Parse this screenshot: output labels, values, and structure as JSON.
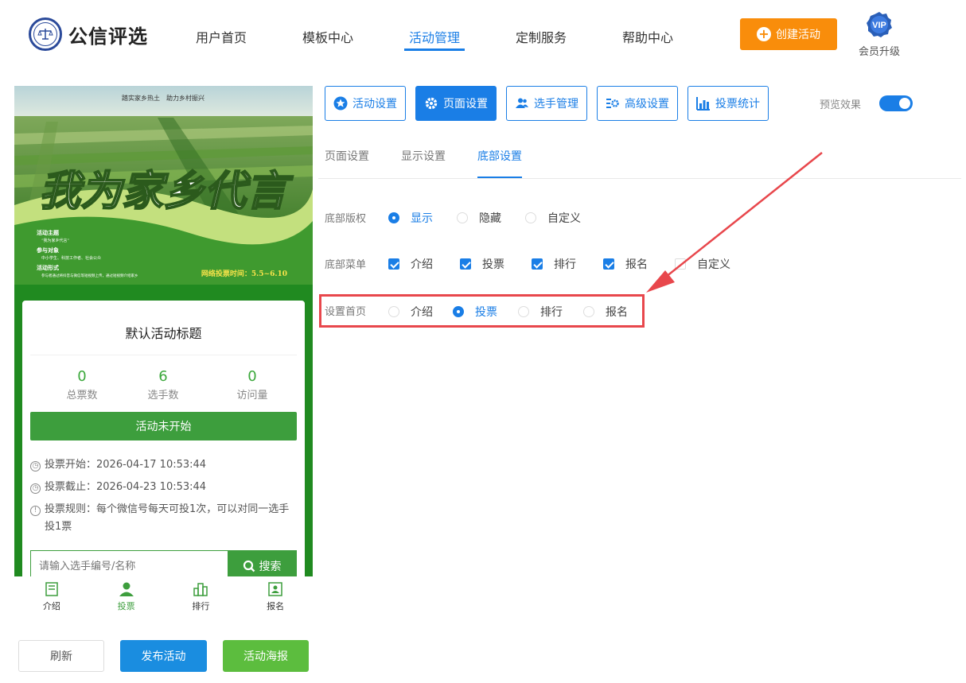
{
  "header": {
    "brand": "公信评选",
    "nav": [
      "用户首页",
      "模板中心",
      "活动管理",
      "定制服务",
      "帮助中心"
    ],
    "active_nav": "活动管理",
    "create_label": "创建活动",
    "vip_badge": "VIP",
    "vip_label": "会员升级"
  },
  "banner": {
    "slogan": "踏实家乡热土　助力乡村振兴",
    "title": "我为家乡代言",
    "theme_label": "活动主题",
    "theme_value": "“我为家乡代言”",
    "target_label": "参与对象",
    "target_value": "中小学生、科技工作者、社会公众",
    "form_label": "活动形式",
    "form_value": "参与者通过将抖音与微信等短视频上传，通过短视频介绍家乡",
    "vote_time": "网络投票时间：5.5~6.10"
  },
  "card": {
    "title": "默认活动标题",
    "stats": [
      {
        "value": "0",
        "label": "总票数"
      },
      {
        "value": "6",
        "label": "选手数"
      },
      {
        "value": "0",
        "label": "访问量"
      }
    ],
    "status": "活动未开始",
    "start": "投票开始：2026-04-17 10:53:44",
    "end": "投票截止：2026-04-23 10:53:44",
    "rule": "投票规则：每个微信号每天可投1次，可以对同一选手投1票",
    "search_placeholder": "请输入选手编号/名称",
    "search_button": "搜索"
  },
  "tabbar": [
    {
      "label": "介绍",
      "icon": "intro-icon"
    },
    {
      "label": "投票",
      "icon": "person-icon"
    },
    {
      "label": "排行",
      "icon": "rank-icon"
    },
    {
      "label": "报名",
      "icon": "signup-icon"
    }
  ],
  "bottom_buttons": {
    "refresh": "刷新",
    "publish": "发布活动",
    "poster": "活动海报"
  },
  "toolbar": {
    "buttons": [
      "活动设置",
      "页面设置",
      "选手管理",
      "高级设置",
      "投票统计"
    ],
    "active": "页面设置",
    "preview_label": "预览效果",
    "preview_on": true
  },
  "subtabs": [
    "页面设置",
    "显示设置",
    "底部设置"
  ],
  "active_subtab": "底部设置",
  "settings": {
    "copyright": {
      "label": "底部版权",
      "options": [
        "显示",
        "隐藏",
        "自定义"
      ],
      "selected": "显示"
    },
    "menu": {
      "label": "底部菜单",
      "options": [
        {
          "label": "介绍",
          "checked": true
        },
        {
          "label": "投票",
          "checked": true
        },
        {
          "label": "排行",
          "checked": true
        },
        {
          "label": "报名",
          "checked": true
        },
        {
          "label": "自定义",
          "checked": false
        }
      ]
    },
    "homepage": {
      "label": "设置首页",
      "options": [
        "介绍",
        "投票",
        "排行",
        "报名"
      ],
      "selected": "投票"
    }
  },
  "colors": {
    "primary": "#1a7ee6",
    "orange": "#f98d0b",
    "green": "#3d9e3d",
    "annotation_red": "#e8474c"
  }
}
